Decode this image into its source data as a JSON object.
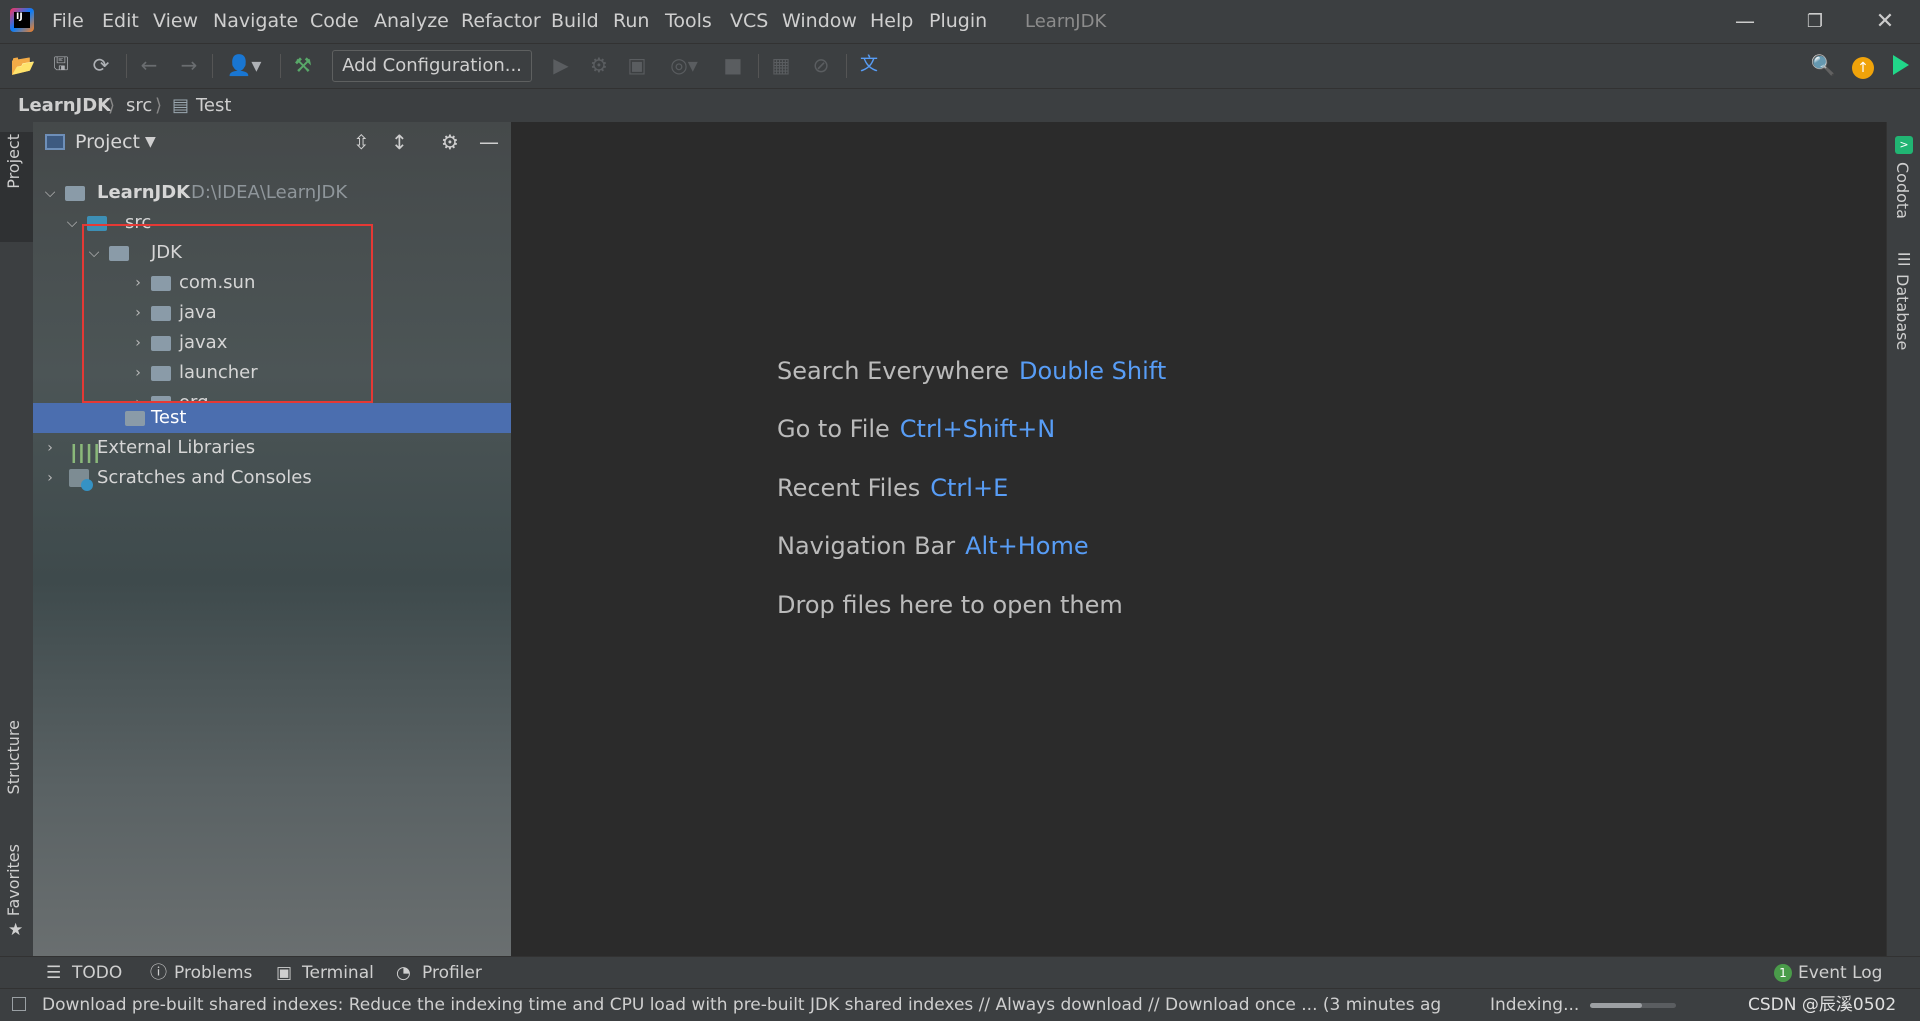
{
  "title_bar": {
    "app_title": "LearnJDK",
    "menu": [
      "File",
      "Edit",
      "View",
      "Navigate",
      "Code",
      "Analyze",
      "Refactor",
      "Build",
      "Run",
      "Tools",
      "VCS",
      "Window",
      "Help",
      "Plugin"
    ]
  },
  "toolbar": {
    "add_configuration": "Add Configuration...",
    "icons": [
      "folder-open-icon",
      "save-icon",
      "sync-icon",
      "back-icon",
      "forward-icon",
      "user-icon",
      "build-hammer-icon",
      "run-icon",
      "debug-icon",
      "coverage-icon",
      "profile-icon",
      "stop-icon",
      "translate-icon",
      "search-icon",
      "update-icon",
      "jetbrains-toolbox-icon"
    ]
  },
  "breadcrumb": [
    "LearnJDK",
    "src",
    "Test"
  ],
  "left_stripe": {
    "project": "Project",
    "structure": "Structure",
    "favorites": "Favorites"
  },
  "right_stripe": {
    "codota": "Codota",
    "database": "Database"
  },
  "project_panel": {
    "title": "Project",
    "root": {
      "name": "LearnJDK",
      "path": "D:\\IDEA\\LearnJDK"
    },
    "src": "src",
    "jdk": "JDK",
    "packages": [
      "com.sun",
      "java",
      "javax",
      "launcher",
      "org"
    ],
    "test": "Test",
    "external_libraries": "External Libraries",
    "scratches": "Scratches and Consoles"
  },
  "editor_hints": [
    {
      "label": "Search Everywhere",
      "key": "Double Shift"
    },
    {
      "label": "Go to File",
      "key": "Ctrl+Shift+N"
    },
    {
      "label": "Recent Files",
      "key": "Ctrl+E"
    },
    {
      "label": "Navigation Bar",
      "key": "Alt+Home"
    },
    {
      "label": "Drop files here to open them",
      "key": ""
    }
  ],
  "bottom_tools": {
    "todo": "TODO",
    "problems": "Problems",
    "terminal": "Terminal",
    "profiler": "Profiler",
    "event_log": "Event Log",
    "event_count": "1"
  },
  "status": {
    "message": "Download pre-built shared indexes: Reduce the indexing time and CPU load with pre-built JDK shared indexes // Always download // Download once ... (3 minutes ag",
    "indexing": "Indexing...",
    "watermark": "CSDN @辰溪0502"
  },
  "colors": {
    "accent": "#589df6",
    "selection": "#4b6eaf",
    "highlight_box": "#e53935"
  }
}
